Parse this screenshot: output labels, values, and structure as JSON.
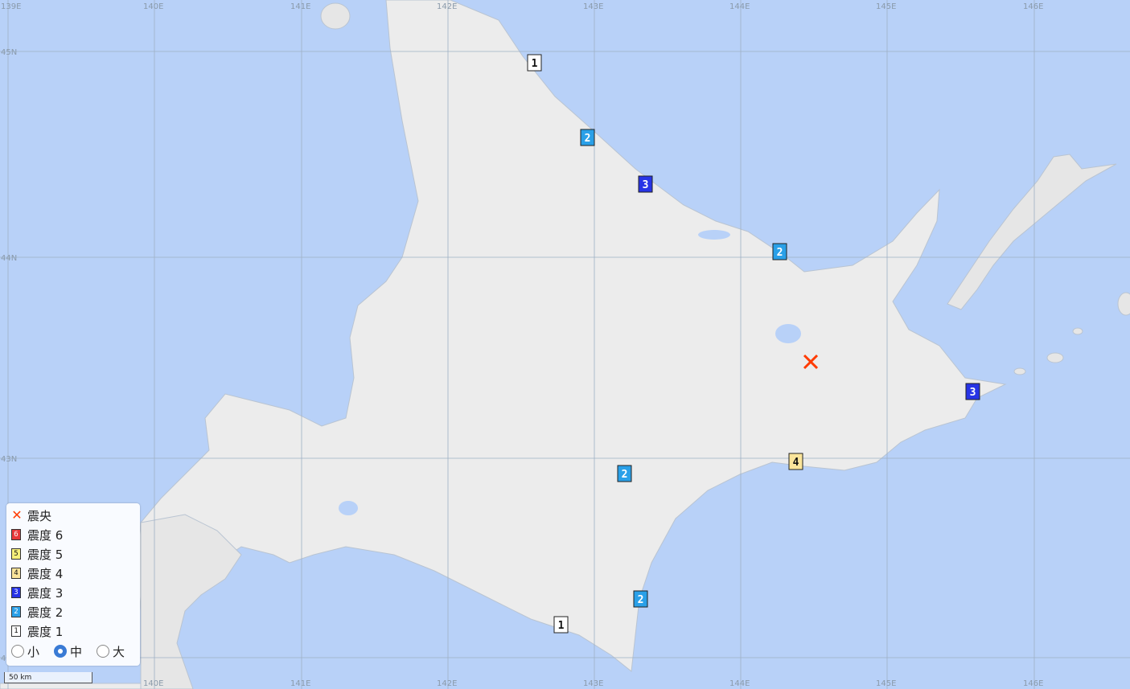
{
  "grid": {
    "lon_labels": [
      "139E",
      "140E",
      "141E",
      "142E",
      "143E",
      "144E",
      "145E",
      "146E"
    ],
    "lat_labels": [
      "45N",
      "44N",
      "43N",
      "42N"
    ]
  },
  "intensity_markers": [
    {
      "label": "1",
      "level": 1
    },
    {
      "label": "2",
      "level": 2
    },
    {
      "label": "3",
      "level": 3
    },
    {
      "label": "2",
      "level": 2
    },
    {
      "label": "3",
      "level": 3
    },
    {
      "label": "4",
      "level": 4
    },
    {
      "label": "2",
      "level": 2
    },
    {
      "label": "2",
      "level": 2
    },
    {
      "label": "1",
      "level": 1
    }
  ],
  "colors": {
    "sea": "#b8d1f8",
    "land": "#ececec",
    "level1": "#ffffff",
    "level2": "#2aa0e8",
    "level3": "#2734e6",
    "level4": "#fbe59b",
    "level5": "#f6f07a",
    "level6": "#e8383a",
    "epicenter": "#ff3b00"
  },
  "legend": {
    "epicenter": "震央",
    "levels": [
      {
        "num": "6",
        "label": "震度 6"
      },
      {
        "num": "5",
        "label": "震度 5"
      },
      {
        "num": "4",
        "label": "震度 4"
      },
      {
        "num": "3",
        "label": "震度 3"
      },
      {
        "num": "2",
        "label": "震度 2"
      },
      {
        "num": "1",
        "label": "震度 1"
      }
    ],
    "sizes": {
      "small": "小",
      "medium": "中",
      "large": "大",
      "selected": "中"
    }
  },
  "scale": "50 km"
}
